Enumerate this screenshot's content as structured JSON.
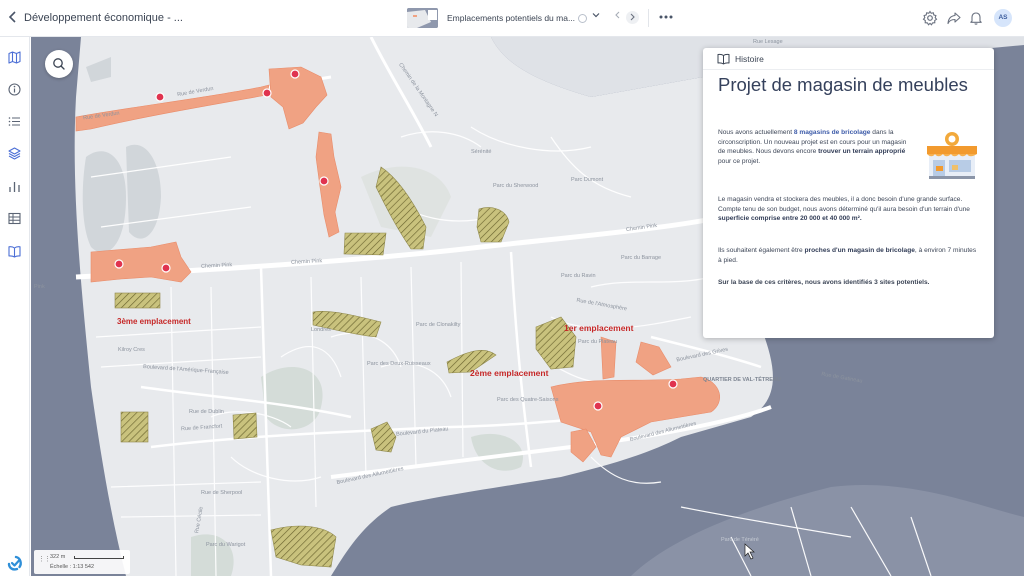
{
  "topbar": {
    "back_icon": "chevron-left-icon",
    "app_title": "Développement économique - ...",
    "doc_title": "Emplacements potentiels du ma...",
    "dropdown_icon": "chevron-down-icon",
    "prev_icon": "chevron-left-icon",
    "next_icon": "chevron-right-icon",
    "more_icon": "more-horizontal-icon",
    "right_icons": [
      "settings-icon",
      "share-icon",
      "notification-bell-icon"
    ],
    "avatar_initials": "AS"
  },
  "sidebar": {
    "items": [
      "map-icon",
      "info-icon",
      "list-icon",
      "layers-icon",
      "chart-icon",
      "table-icon",
      "book-icon"
    ],
    "brand_icon": "brand-logo-icon"
  },
  "map": {
    "search_icon": "search-icon",
    "streets": [
      "Rue de Verdun",
      "Rue de Verdun",
      "Chemin Pink",
      "Chemin Pink",
      "Chemin Pink",
      "Pink",
      "Boulevard de l'Amérique-Française",
      "Rue de Dublin",
      "Rue de Francfort",
      "Rue de Sherpool",
      "Boulevard du Plateau",
      "Boulevard des Allumettières",
      "Boulevard des Allumettières",
      "Rue de l'Atmosphère",
      "Boulevard des Grives",
      "Rue de Gatineau",
      "Kilroy Cres",
      "Rue Cécile",
      "Chemin de la Montagne N",
      "Rue Lesage"
    ],
    "places": [
      "Parc du Sherwood",
      "Parc du Plateau",
      "Parc des Deux-Ruisseaux",
      "Parc des Quatre-Saisons",
      "Parc du Ravin",
      "Parc du Barrage",
      "QUARTIER DE VAL-TÉTREAU",
      "Londres",
      "Parc de Clonakilty",
      "Parc de Ténéré",
      "Parc du Warigot",
      "Sérénité",
      "Parc Dumont"
    ],
    "sites": {
      "first": "1er emplacement",
      "second": "2ème emplacement",
      "third": "3ème emplacement"
    },
    "scale": {
      "distance": "322 m",
      "ratio": "Échelle : 1:13 542"
    },
    "colors": {
      "land": "#e9ebee",
      "water": "#7a8399",
      "park": "#d7ddda",
      "commercial_zone": "#f0a283",
      "candidate_site": "#c9c27d",
      "marker": "#e0334f"
    }
  },
  "story": {
    "tab_label": "Histoire",
    "title": "Projet de magasin de meubles",
    "p1": {
      "a": "Nous avons actuellement ",
      "b": "8 magasins de bricolage",
      "c": " dans la circonscription. Un nouveau projet est en cours pour un magasin de meubles. Nous devons encore ",
      "d": "trouver un terrain approprié",
      "e": " pour ce projet."
    },
    "p2": {
      "a": "Le magasin vendra et stockera des meubles, il a donc besoin d'une grande surface. Compte tenu de son budget, nous avons déterminé qu'il aura besoin d'un terrain d'une ",
      "b": "superficie comprise entre 20 000 et 40 000 m².",
      "c": ""
    },
    "p3": {
      "a": "Ils souhaitent également être ",
      "b": "proches d'un magasin de bricolage",
      "c": ", à environ 7 minutes à pied."
    },
    "p4": "Sur la base de ces critères, nous avons identifiés 3 sites potentiels.",
    "illustration_icon": "storefront-icon"
  }
}
